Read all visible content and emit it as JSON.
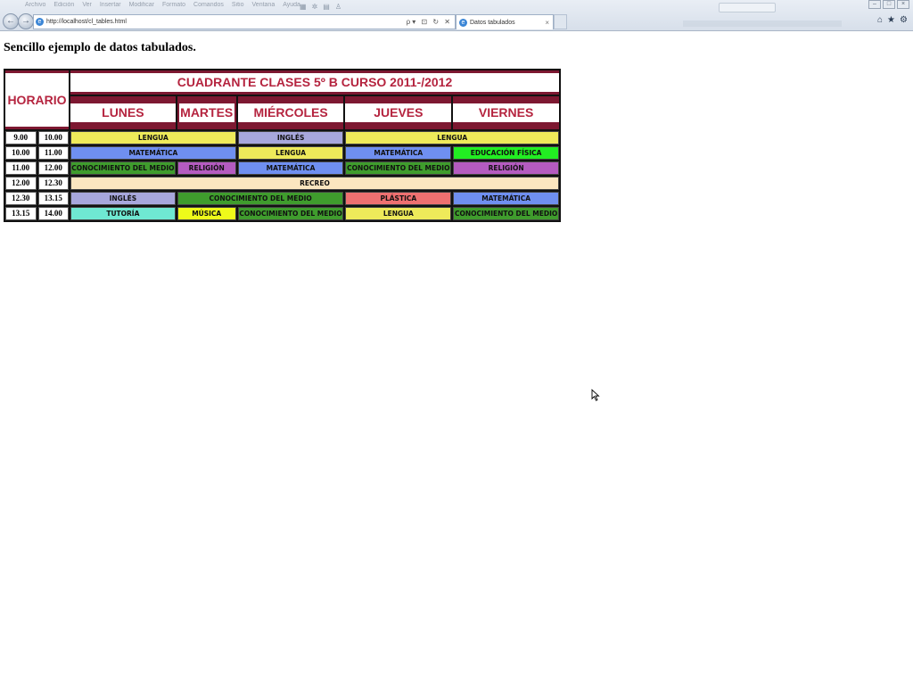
{
  "browser": {
    "menu": [
      "Archivo",
      "Edición",
      "Ver",
      "Insertar",
      "Modificar",
      "Formato",
      "Comandos",
      "Sitio",
      "Ventana",
      "Ayuda"
    ],
    "address_url": "http://localhost/cl_tables.html",
    "tab_title": "Datos tabulados",
    "tab_close": "×",
    "back_glyph": "←",
    "forward_glyph": "→",
    "address_tools": "ρ▾ ⊡ ↻ ✕",
    "home_glyph": "⌂",
    "star_glyph": "★",
    "gear_glyph": "⚙",
    "win_min": "–",
    "win_max": "□",
    "win_close": "×"
  },
  "page": {
    "heading": "Sencillo ejemplo de datos tabulados.",
    "title": "CUADRANTE CLASES 5º B CURSO 2011-/2012",
    "horario": "HORARIO",
    "days": [
      "LUNES",
      "MARTES",
      "MIÉRCOLES",
      "JUEVES",
      "VIERNES"
    ]
  },
  "colors": {
    "header_bg": "#7d1831",
    "header_text": "#b5243f",
    "table_bg": "#111111",
    "cell_bg": "#222222",
    "lengua": "#eeea5a",
    "ingles": "#a7a7dc",
    "matematica": "#6f8ff0",
    "educacion_fisica": "#22ee22",
    "conocimiento": "#3f9c2d",
    "religion": "#b45bc0",
    "recreo": "#fbe6c0",
    "plastica": "#ee7070",
    "tutoria": "#6fe8d2",
    "musica": "#eefa1a"
  },
  "rows": [
    {
      "start": "9.00",
      "end": "10.00",
      "cells": [
        {
          "label": "LENGUA",
          "span": 2,
          "color": "#eeea5a"
        },
        {
          "label": "INGLÉS",
          "span": 1,
          "color": "#a7a7dc"
        },
        {
          "label": "LENGUA",
          "span": 2,
          "color": "#eeea5a"
        }
      ]
    },
    {
      "start": "10.00",
      "end": "11.00",
      "cells": [
        {
          "label": "MATEMÁTICA",
          "span": 2,
          "color": "#6f8ff0"
        },
        {
          "label": "LENGUA",
          "span": 1,
          "color": "#eeea5a"
        },
        {
          "label": "MATEMÁTICA",
          "span": 1,
          "color": "#6f8ff0"
        },
        {
          "label": "EDUCACIÓN FÍSICA",
          "span": 1,
          "color": "#22ee22"
        }
      ]
    },
    {
      "start": "11.00",
      "end": "12.00",
      "cells": [
        {
          "label": "CONOCIMIENTO DEL MEDIO",
          "span": 1,
          "color": "#3f9c2d"
        },
        {
          "label": "RELIGIÓN",
          "span": 1,
          "color": "#b45bc0"
        },
        {
          "label": "MATEMÁTICA",
          "span": 1,
          "color": "#6f8ff0"
        },
        {
          "label": "CONOCIMIENTO DEL MEDIO",
          "span": 1,
          "color": "#3f9c2d"
        },
        {
          "label": "RELIGIÓN",
          "span": 1,
          "color": "#b45bc0"
        }
      ]
    },
    {
      "start": "12.00",
      "end": "12.30",
      "cells": [
        {
          "label": "RECREO",
          "span": 5,
          "color": "#fbe6c0"
        }
      ]
    },
    {
      "start": "12.30",
      "end": "13.15",
      "cells": [
        {
          "label": "INGLÉS",
          "span": 1,
          "color": "#a7a7dc"
        },
        {
          "label": "CONOCIMIENTO DEL MEDIO",
          "span": 2,
          "color": "#3f9c2d"
        },
        {
          "label": "PLÁSTICA",
          "span": 1,
          "color": "#ee7070"
        },
        {
          "label": "MATEMÁTICA",
          "span": 1,
          "color": "#6f8ff0"
        }
      ]
    },
    {
      "start": "13.15",
      "end": "14.00",
      "cells": [
        {
          "label": "TUTORÍA",
          "span": 1,
          "color": "#6fe8d2"
        },
        {
          "label": "MÚSICA",
          "span": 1,
          "color": "#eefa1a"
        },
        {
          "label": "CONOCIMIENTO DEL MEDIO",
          "span": 1,
          "color": "#3f9c2d"
        },
        {
          "label": "LENGUA",
          "span": 1,
          "color": "#eeea5a"
        },
        {
          "label": "CONOCIMIENTO DEL MEDIO",
          "span": 1,
          "color": "#3f9c2d"
        }
      ]
    }
  ]
}
